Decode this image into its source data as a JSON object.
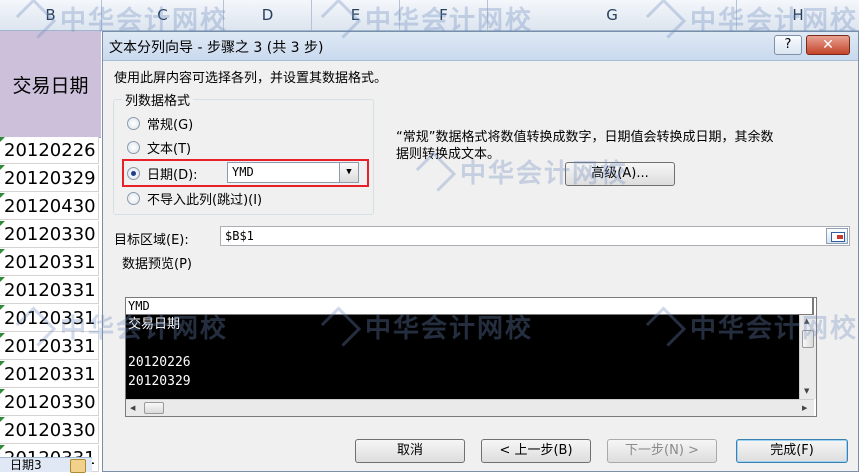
{
  "sheet": {
    "column_headers": [
      "B",
      "C",
      "D",
      "E",
      "F",
      "G",
      "H"
    ],
    "header_cell": "交易日期",
    "cells": [
      "20120226",
      "20120329",
      "20120430",
      "20120330",
      "20120331",
      "20120331",
      "20120331",
      "20120331",
      "20120331",
      "20120330",
      "20120330",
      "20120331"
    ],
    "sheet_tab": "日期3"
  },
  "watermark": "中华会计网校",
  "dialog": {
    "title": "文本分列向导 - 步骤之 3 (共 3 步)",
    "help_label": "?",
    "close_label": "✕",
    "instruction": "使用此屏内容可选择各列，并设置其数据格式。",
    "group_label": "列数据格式",
    "options": [
      {
        "label": "常规(G)",
        "checked": false
      },
      {
        "label": "文本(T)",
        "checked": false
      },
      {
        "label": "日期(D):",
        "checked": true
      },
      {
        "label": "不导入此列(跳过)(I)",
        "checked": false
      }
    ],
    "date_format": "YMD",
    "description_line1": "“常规”数据格式将数值转换成数字，日期值会转换成日期，其余数",
    "description_line2": "据则转换成文本。",
    "advanced_label": "高级(A)...",
    "target_label": "目标区域(E):",
    "target_value": "$B$1",
    "preview_label": "数据预览(P)",
    "preview_col_header": "YMD",
    "preview_rows": [
      "交易日期",
      "",
      "20120226",
      "20120329"
    ],
    "buttons": {
      "cancel": "取消",
      "back": "< 上一步(B)",
      "next": "下一步(N) >",
      "finish": "完成(F)"
    }
  }
}
